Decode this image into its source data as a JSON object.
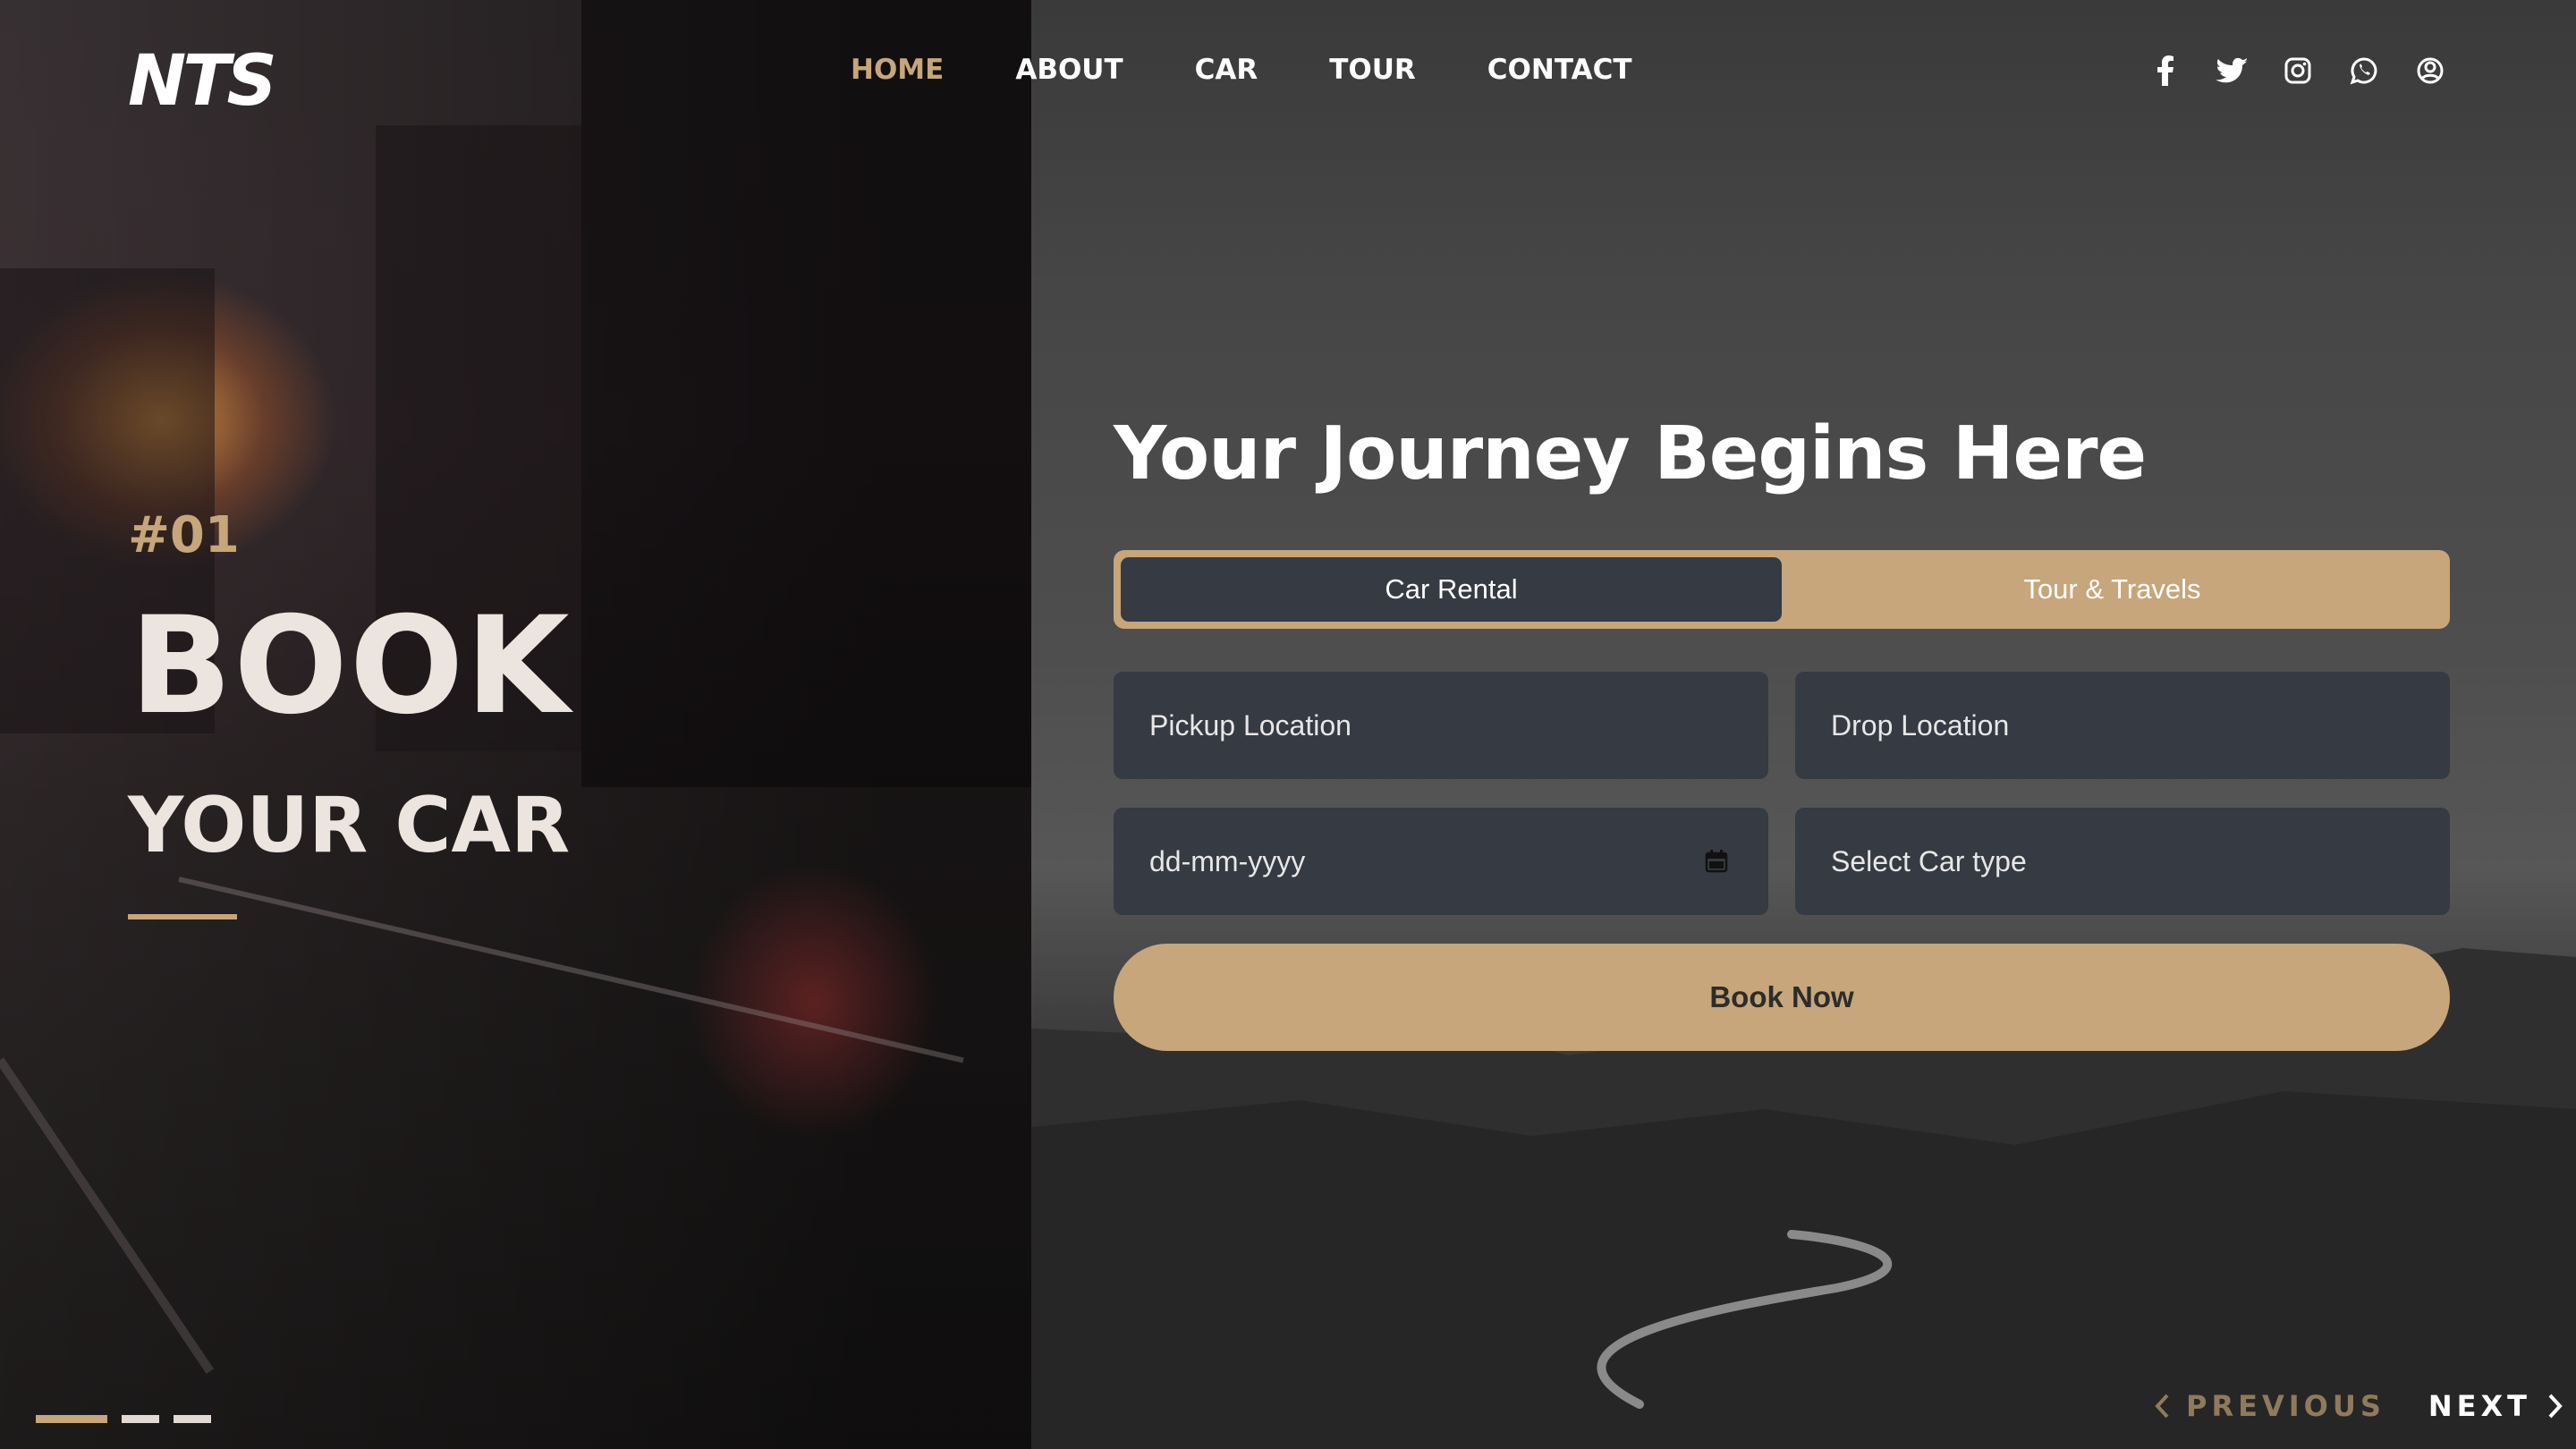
{
  "brand": {
    "logo_text": "NTS"
  },
  "nav": {
    "items": [
      {
        "label": "HOME",
        "active": true
      },
      {
        "label": "ABOUT"
      },
      {
        "label": "CAR"
      },
      {
        "label": "TOUR"
      },
      {
        "label": "CONTACT"
      }
    ]
  },
  "social_icons": [
    "facebook-icon",
    "twitter-icon",
    "instagram-icon",
    "whatsapp-icon",
    "user-icon"
  ],
  "hero": {
    "slide_number": "#01",
    "title_line1": "BOOK",
    "title_line2": "YOUR CAR",
    "slides_total": 3,
    "active_slide": 1
  },
  "booking": {
    "title": "Your Journey Begins Here",
    "tabs": [
      {
        "label": "Car Rental",
        "active": true
      },
      {
        "label": "Tour & Travels",
        "active": false
      }
    ],
    "pickup_placeholder": "Pickup Location",
    "drop_placeholder": "Drop Location",
    "date_placeholder": "dd-mm-yyyy",
    "car_type_placeholder": "Select Car type",
    "submit_label": "Book Now"
  },
  "pager": {
    "prev_label": "PREVIOUS",
    "next_label": "NEXT"
  },
  "colors": {
    "accent": "#c6a67a",
    "field_bg": "#363a43",
    "text_light": "#ece4df"
  }
}
